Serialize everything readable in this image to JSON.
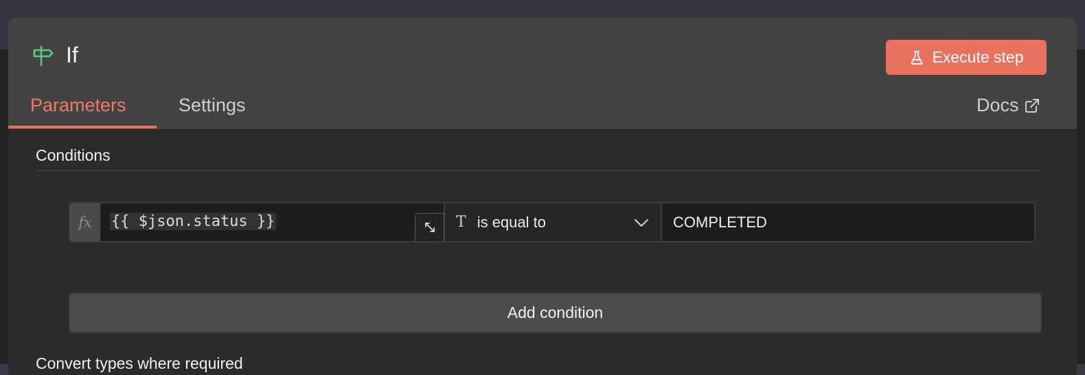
{
  "node": {
    "title": "If",
    "icon": "signpost-icon",
    "execute_label": "Execute step",
    "execute_icon": "flask-icon",
    "accent_color": "#e8715f",
    "icon_color": "#5fc97e"
  },
  "tabs": [
    {
      "label": "Parameters",
      "active": true
    },
    {
      "label": "Settings",
      "active": false
    }
  ],
  "docs": {
    "label": "Docs",
    "icon": "external-link-icon"
  },
  "conditions": {
    "section_title": "Conditions",
    "rows": [
      {
        "fx_label": "fx",
        "expression": "{{ $json.status }}",
        "operator_type_glyph": "T",
        "operator": "is equal to",
        "value": "COMPLETED"
      }
    ],
    "add_label": "Add condition"
  },
  "footer_text": "Convert types where required"
}
